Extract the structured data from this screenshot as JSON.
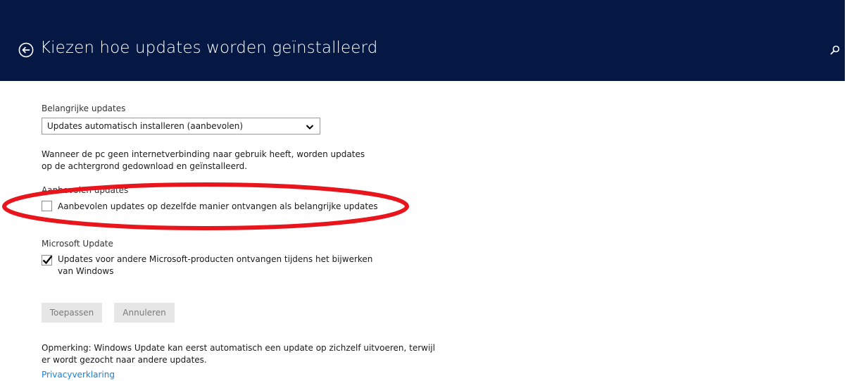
{
  "header": {
    "title": "Kiezen hoe updates worden geïnstalleerd",
    "back_icon": "back-arrow-circle-icon",
    "search_icon": "search-icon",
    "background": "#041843"
  },
  "important_updates": {
    "label": "Belangrijke updates",
    "selected": "Updates automatisch installeren (aanbevolen)",
    "description": "Wanneer de pc geen internetverbinding naar gebruik heeft, worden updates op de achtergrond gedownload en geïnstalleerd."
  },
  "recommended_updates": {
    "label": "Aanbevolen updates",
    "checkbox_label": "Aanbevolen updates op dezelfde manier ontvangen als belangrijke updates",
    "checked": false
  },
  "microsoft_update": {
    "label": "Microsoft Update",
    "checkbox_label": "Updates voor andere Microsoft-producten ontvangen tijdens het bijwerken van Windows",
    "checked": true
  },
  "buttons": {
    "apply": "Toepassen",
    "cancel": "Annuleren"
  },
  "note": "Opmerking: Windows Update kan eerst automatisch een update op zichzelf uitvoeren, terwijl er wordt gezocht naar andere updates.",
  "privacy_link": "Privacyverklaring",
  "colors": {
    "link": "#1a7fd1",
    "annotation": "#e8151c"
  }
}
